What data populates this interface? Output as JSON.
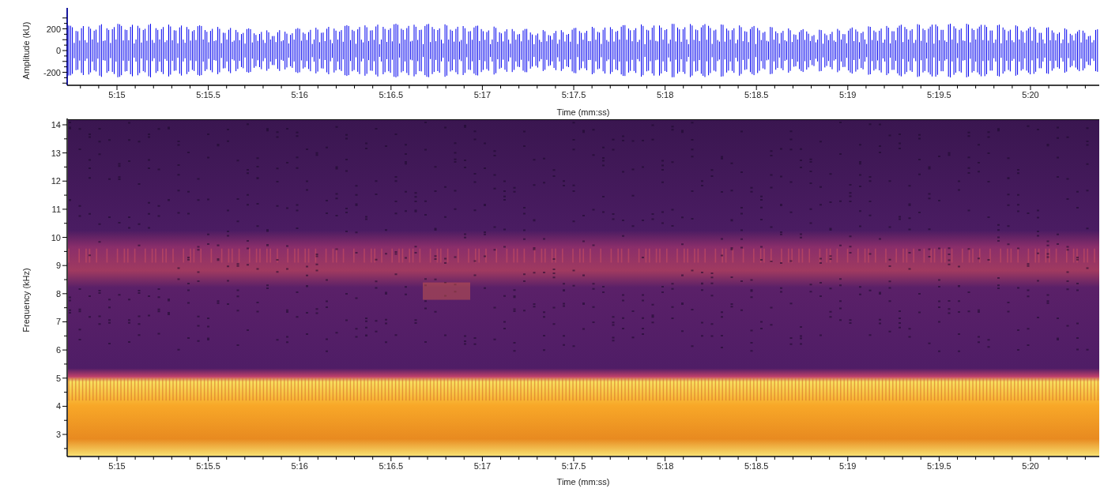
{
  "waveform": {
    "y_axis_title": "Amplitude (kU)",
    "y_ticks": [
      "200",
      "0",
      "-200"
    ],
    "x_ticks": [
      "5:15",
      "5:15.5",
      "5:16",
      "5:16.5",
      "5:17",
      "5:17.5",
      "5:18",
      "5:18.5",
      "5:19",
      "5:19.5",
      "5:20"
    ],
    "x_axis_title": "Time (mm:ss)"
  },
  "spectrogram": {
    "y_axis_title": "Frequency (kHz)",
    "y_ticks": [
      "14",
      "13",
      "12",
      "11",
      "10",
      "9",
      "8",
      "7",
      "6",
      "5",
      "4",
      "3"
    ],
    "x_ticks": [
      "5:15",
      "5:15.5",
      "5:16",
      "5:16.5",
      "5:17",
      "5:17.5",
      "5:18",
      "5:18.5",
      "5:19",
      "5:19.5",
      "5:20"
    ],
    "x_axis_title": "Time (mm:ss)"
  }
}
